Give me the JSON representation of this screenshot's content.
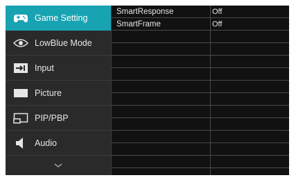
{
  "menu": {
    "items": [
      {
        "label": "Game Setting",
        "icon": "gamepad-icon",
        "active": true
      },
      {
        "label": "LowBlue Mode",
        "icon": "eye-icon",
        "active": false
      },
      {
        "label": "Input",
        "icon": "input-icon",
        "active": false
      },
      {
        "label": "Picture",
        "icon": "picture-icon",
        "active": false
      },
      {
        "label": "PIP/PBP",
        "icon": "pip-icon",
        "active": false
      },
      {
        "label": "Audio",
        "icon": "speaker-icon",
        "active": false
      }
    ],
    "more_icon": "chevron-down-icon"
  },
  "settings": {
    "rows": [
      {
        "name": "SmartResponse",
        "value": "Off"
      },
      {
        "name": "SmartFrame",
        "value": "Off"
      },
      {
        "name": "",
        "value": ""
      },
      {
        "name": "",
        "value": ""
      },
      {
        "name": "",
        "value": ""
      },
      {
        "name": "",
        "value": ""
      },
      {
        "name": "",
        "value": ""
      },
      {
        "name": "",
        "value": ""
      },
      {
        "name": "",
        "value": ""
      },
      {
        "name": "",
        "value": ""
      },
      {
        "name": "",
        "value": ""
      },
      {
        "name": "",
        "value": ""
      },
      {
        "name": "",
        "value": ""
      }
    ]
  },
  "colors": {
    "accent": "#18a3b3",
    "menu_bg": "#2a2a2a",
    "panel_bg": "#111111",
    "divider": "#4a4a4a"
  }
}
